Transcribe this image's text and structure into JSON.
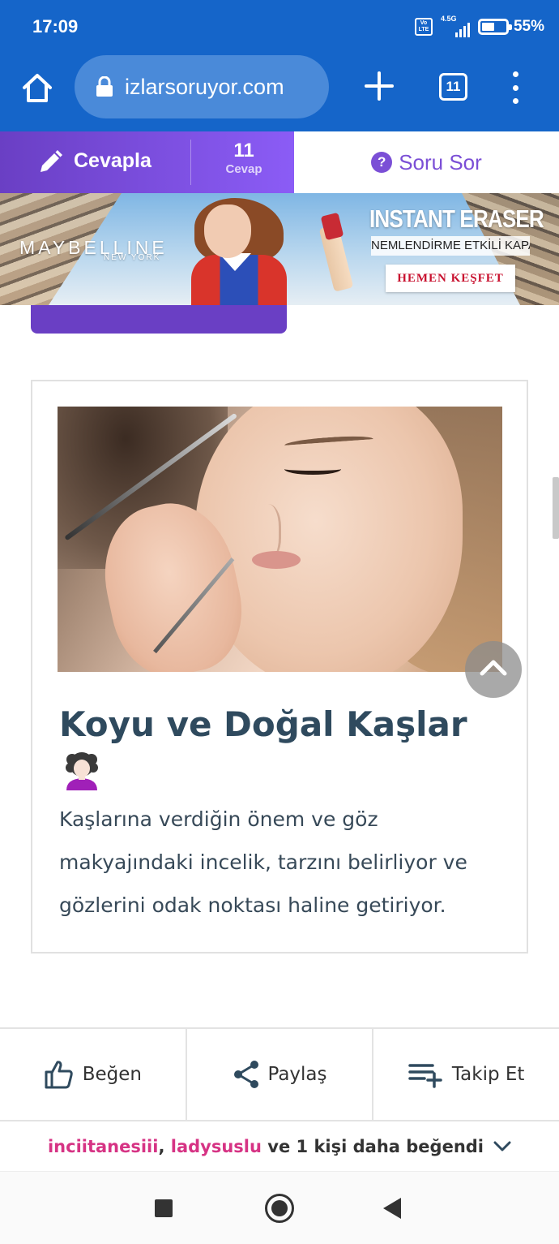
{
  "status_bar": {
    "time": "17:09",
    "network": "4.5G",
    "volte": "Vo LTE",
    "battery_percent": 55,
    "battery_label": "55%"
  },
  "browser": {
    "url": "izlarsoruyor.com",
    "tab_count": "11",
    "icons": [
      "home-icon",
      "lock-icon",
      "plus-icon",
      "tabs-icon",
      "more-vert-icon"
    ]
  },
  "actions": {
    "answer_label": "Cevapla",
    "answer_count": "11",
    "answer_count_label": "Cevap",
    "ask_label": "Soru Sor",
    "ask_icon": "?"
  },
  "ad": {
    "brand": "MAYBELLINE",
    "brand_sub": "NEW YORK",
    "headline": "INSTANT ERASER",
    "subline": "NEMLENDİRME ETKİLİ KAPATICI",
    "cta": "HEMEN KEŞFET"
  },
  "card": {
    "title": "Koyu ve Doğal Kaşlar",
    "emoji": "woman-curly-hair-emoji",
    "description": "Kaşlarına verdiğin önem ve göz makyajındaki incelik, tarzını belirliyor ve gözlerini odak noktası haline getiriyor."
  },
  "bottom_actions": {
    "like": "Beğen",
    "share": "Paylaş",
    "follow": "Takip Et"
  },
  "likers": {
    "user1": "inciitanesiii",
    "separator": ", ",
    "user2": "ladysuslu",
    "connector": " ve ",
    "count": "1",
    "suffix": " kişi daha beğendi"
  },
  "colors": {
    "browser_blue": "#1565c9",
    "purple": "#7b4fd6",
    "title_text": "#2f4a5e",
    "liker_pink": "#d63384"
  }
}
